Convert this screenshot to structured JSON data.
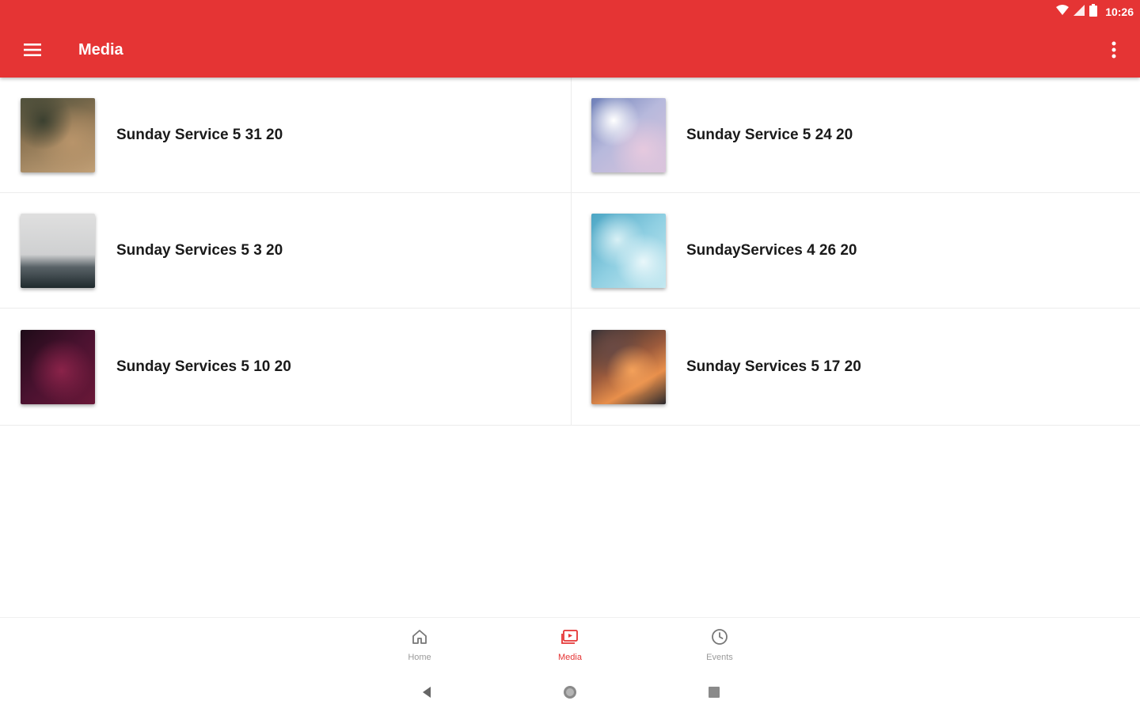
{
  "status": {
    "time": "10:26"
  },
  "appbar": {
    "title": "Media",
    "menu_icon": "hamburger-menu-icon",
    "overflow_icon": "more-vert-icon",
    "color": "#e53434"
  },
  "media_items": [
    {
      "label": "Sunday Service 5 31 20"
    },
    {
      "label": "Sunday Service 5 24 20"
    },
    {
      "label": "Sunday Services 5 3 20"
    },
    {
      "label": "SundayServices 4 26 20"
    },
    {
      "label": "Sunday Services 5 10 20"
    },
    {
      "label": "Sunday Services 5 17 20"
    }
  ],
  "bottom_nav": [
    {
      "label": "Home",
      "icon": "home-icon",
      "active": false
    },
    {
      "label": "Media",
      "icon": "media-icon",
      "active": true
    },
    {
      "label": "Events",
      "icon": "clock-icon",
      "active": false
    }
  ],
  "system_nav": {
    "back_icon": "back-icon",
    "home_icon": "home-circle-icon",
    "recents_icon": "recents-icon"
  }
}
